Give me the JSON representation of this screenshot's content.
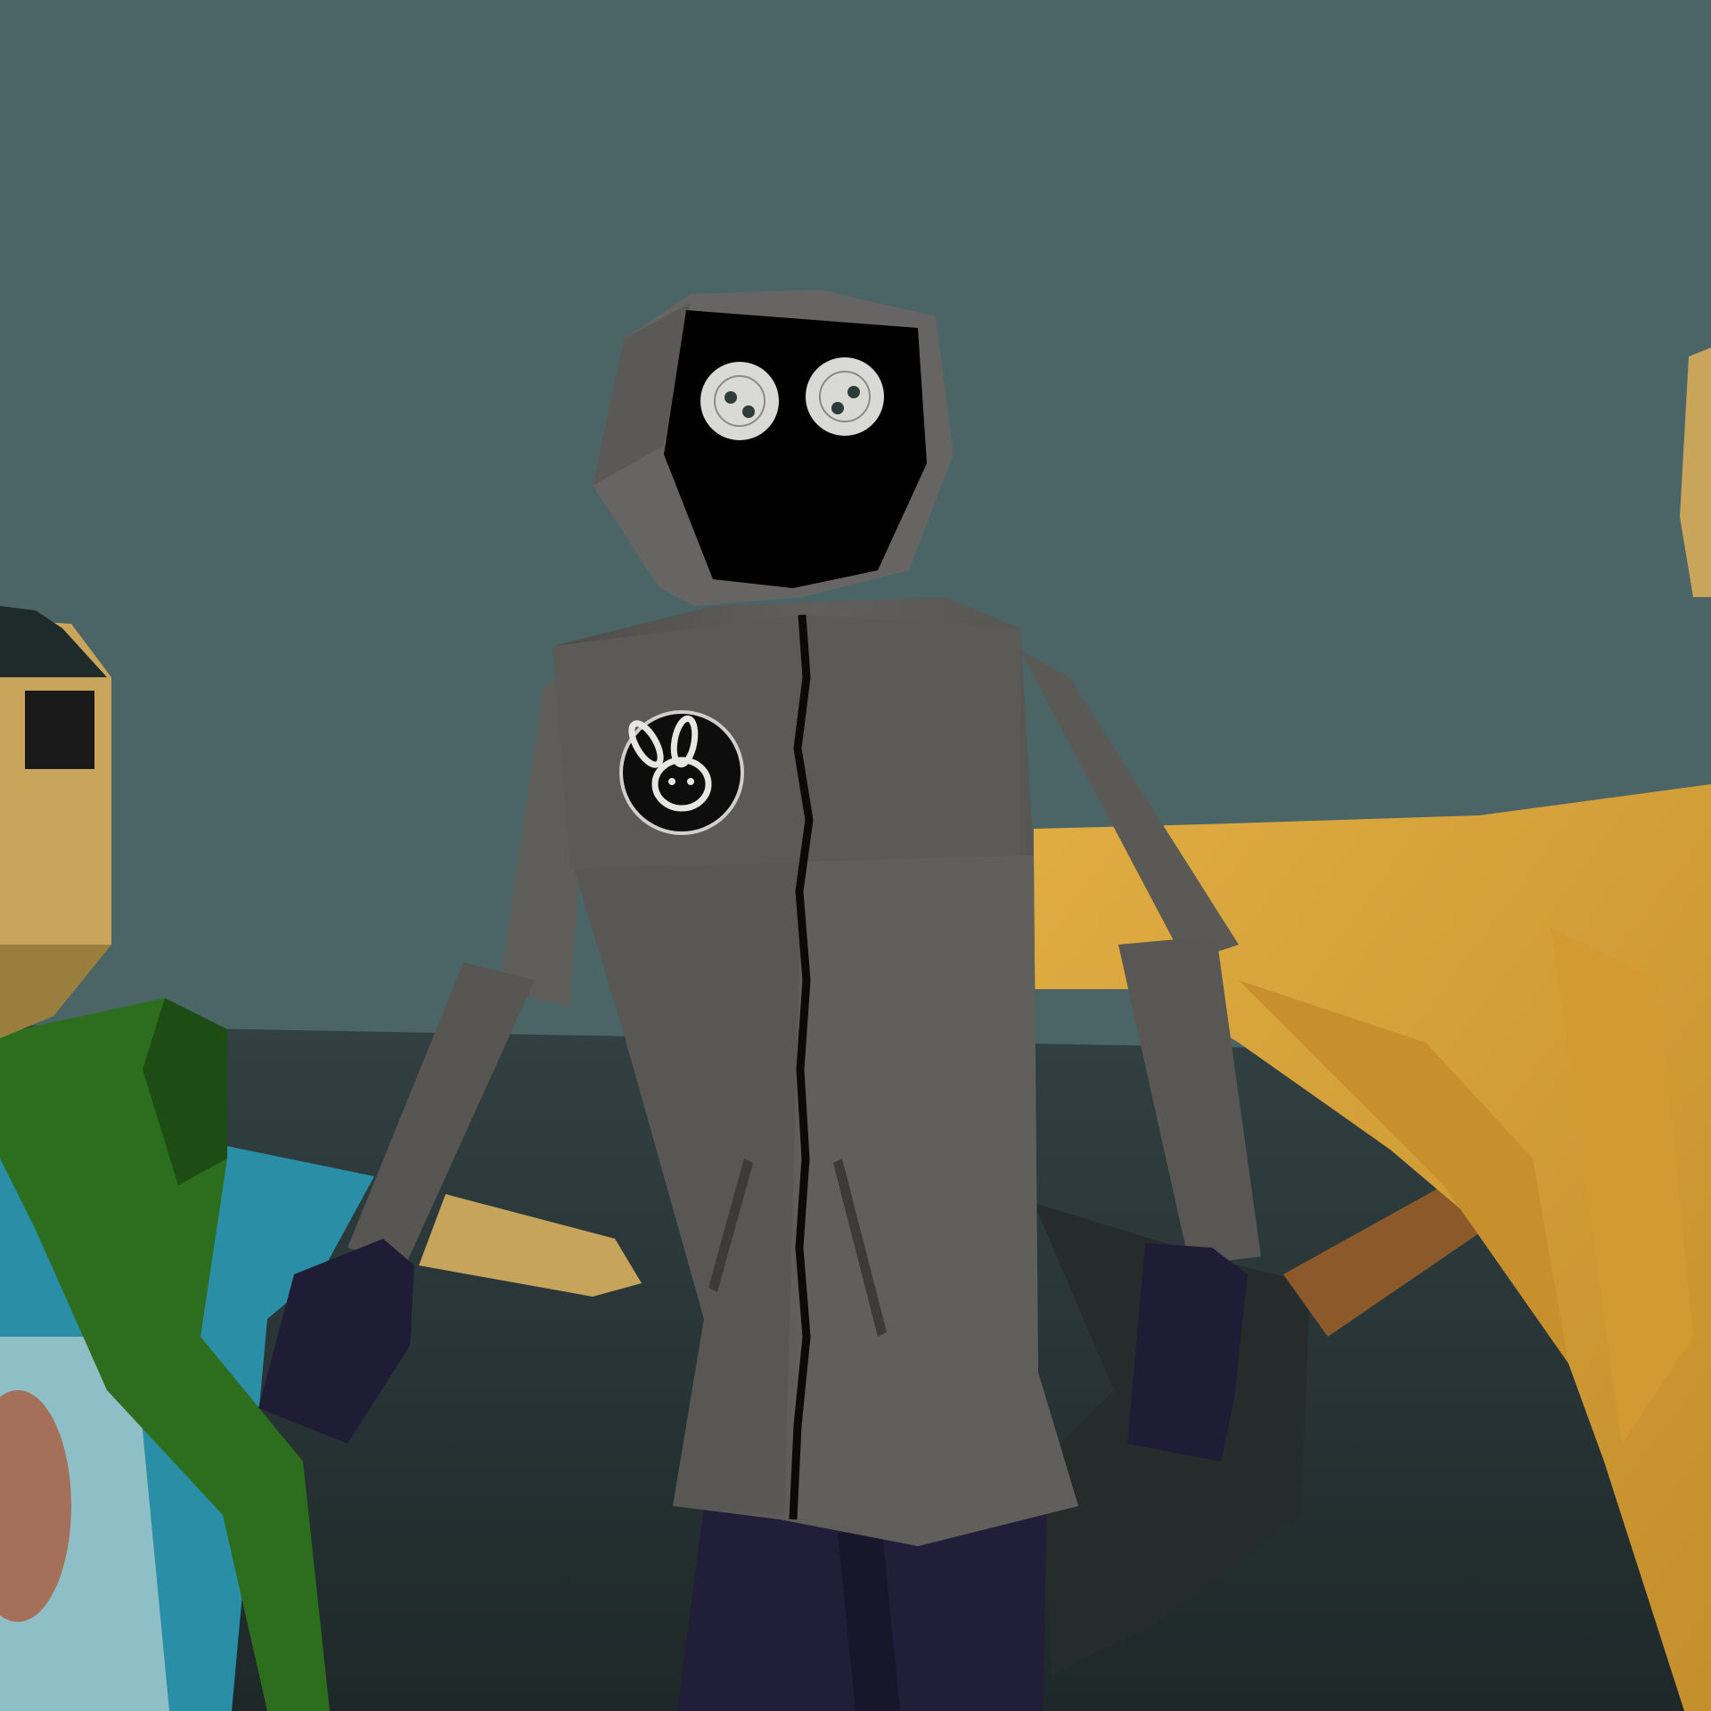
{
  "scene": {
    "description_free": true,
    "colors": {
      "sky": "#4b6466",
      "floor": "#2d3839",
      "floor_dark": "#223031",
      "coat": "#5f5e5b",
      "coat_light": "#6f6e6a",
      "coat_dark": "#434240",
      "hood": "#666563",
      "hood_dark": "#4f4e4c",
      "face_void": "#000000",
      "eye_white": "#d9d9d6",
      "eye_pupil": "#2f3b3a",
      "glove": "#1e1d35",
      "pants": "#201e38",
      "yellow": "#d6a23a",
      "yellow_dark": "#b9852a",
      "green": "#2e6f1e",
      "cyan": "#2a8ea6",
      "pale_cyan": "#8fbfc6",
      "skin_tan": "#c8a55a"
    },
    "icons": {
      "chest_patch": "bunny-face-icon",
      "eyes": "button-eyes-icon"
    }
  }
}
